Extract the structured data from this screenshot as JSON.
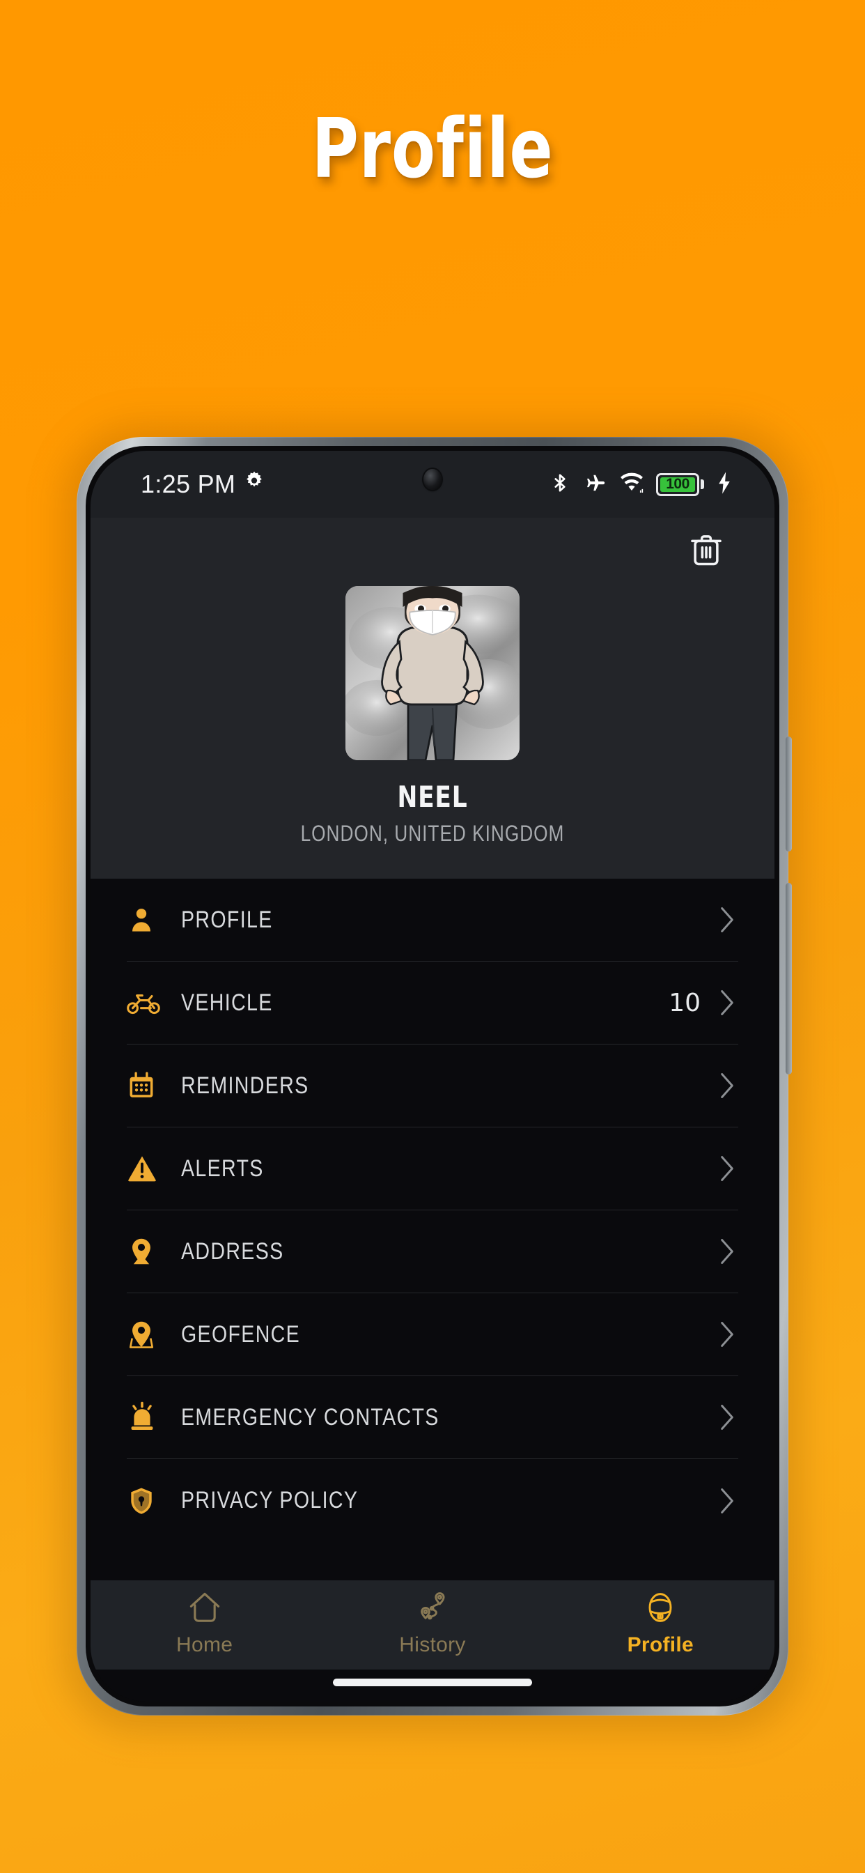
{
  "hero": {
    "title": "Profile"
  },
  "theme": {
    "background_start": "#ff9800",
    "background_end": "#f9a311",
    "accent": "#f0ac33",
    "surface": "#232529",
    "list_background": "#0a0a0d",
    "battery_green": "#37c23b"
  },
  "statusbar": {
    "time": "1:25 PM",
    "gear_icon": "gear-icon",
    "bluetooth_icon": "bluetooth-icon",
    "airplane_icon": "airplane-mode-icon",
    "wifi_icon": "wifi-icon",
    "battery_level": "100",
    "charging_icon": "charging-bolt-icon"
  },
  "topbar": {
    "delete_icon": "trash-icon"
  },
  "profile": {
    "avatar_alt": "masked-cartoon-avatar",
    "name": "NEEL",
    "location": "LONDON, UNITED KINGDOM"
  },
  "menu": {
    "items": [
      {
        "icon": "person-icon",
        "label": "PROFILE",
        "count": ""
      },
      {
        "icon": "motorcycle-icon",
        "label": "VEHICLE",
        "count": "10"
      },
      {
        "icon": "calendar-icon",
        "label": "REMINDERS",
        "count": ""
      },
      {
        "icon": "warning-icon",
        "label": "ALERTS",
        "count": ""
      },
      {
        "icon": "map-pin-icon",
        "label": "ADDRESS",
        "count": ""
      },
      {
        "icon": "geofence-icon",
        "label": "GEOFENCE",
        "count": ""
      },
      {
        "icon": "siren-icon",
        "label": "EMERGENCY CONTACTS",
        "count": ""
      },
      {
        "icon": "shield-lock-icon",
        "label": "PRIVACY POLICY",
        "count": ""
      }
    ]
  },
  "bottomnav": {
    "items": [
      {
        "icon": "home-icon",
        "label": "Home",
        "active": false
      },
      {
        "icon": "route-icon",
        "label": "History",
        "active": false
      },
      {
        "icon": "helmet-icon",
        "label": "Profile",
        "active": true
      }
    ]
  }
}
